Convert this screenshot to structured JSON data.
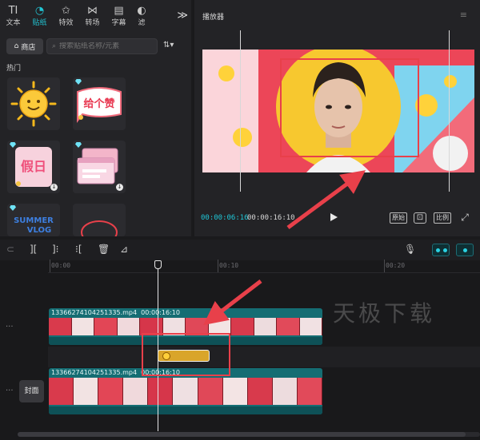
{
  "toolbar": {
    "tabs": [
      {
        "icon": "text-icon",
        "label": "文本",
        "glyph": "TI"
      },
      {
        "icon": "sticker-icon",
        "label": "贴纸",
        "glyph": "◔",
        "active": true
      },
      {
        "icon": "effects-icon",
        "label": "特效",
        "glyph": "✩"
      },
      {
        "icon": "transition-icon",
        "label": "转场",
        "glyph": "⋈"
      },
      {
        "icon": "subtitle-icon",
        "label": "字幕",
        "glyph": "▤"
      },
      {
        "icon": "filter-icon",
        "label": "滤",
        "glyph": "◐"
      }
    ],
    "collapse_glyph": "≫"
  },
  "assets": {
    "shop_label": "商店",
    "search_placeholder": "搜索贴纸名称/元素",
    "section_label": "热门",
    "stickers": [
      {
        "name": "sun-sticker",
        "premium": false
      },
      {
        "name": "give-like-sticker",
        "premium": true,
        "text": "给个赞"
      },
      {
        "name": "holiday-sticker",
        "premium": true,
        "text": "假日"
      },
      {
        "name": "chat-window-sticker",
        "premium": true
      },
      {
        "name": "summer-vlog-sticker",
        "premium": true,
        "text_top": "SUMMER",
        "text_bottom": "VLOG"
      },
      {
        "name": "red-circle-sticker",
        "premium": false
      }
    ]
  },
  "player": {
    "title": "播放器",
    "time_current": "00:00:06:16",
    "time_total": "00:00:16:10",
    "btn_original": "原始",
    "btn_ratio": "比例"
  },
  "timeline": {
    "ruler": [
      {
        "label": "00:00"
      },
      {
        "label": "00:10"
      },
      {
        "label": "00:20"
      }
    ],
    "clips": [
      {
        "file": "1336627410425133​5.mp4",
        "duration": "00:00:16:10"
      },
      {
        "file": "1336627410425133​5.mp4",
        "duration": "00:00:16:10"
      }
    ],
    "cover_label": "封面",
    "watermark": "天极下载"
  },
  "colors": {
    "accent": "#21c5d4",
    "clip": "#156d73",
    "sticker_clip": "#d9a52a",
    "annotation": "#e8404a"
  }
}
